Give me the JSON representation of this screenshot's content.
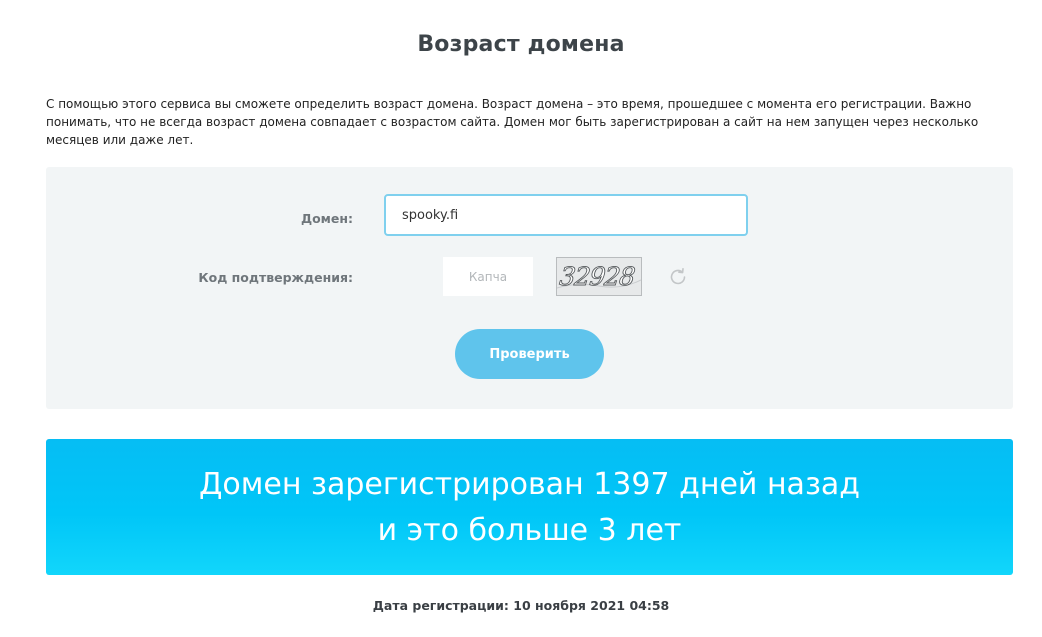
{
  "page": {
    "title": "Возраст домена",
    "description": "С помощью этого сервиса вы сможете определить возраст домена. Возраст домена – это время, прошедшее с момента его регистрации. Важно понимать, что не всегда возраст домена совпадает с возрастом сайта. Домен мог быть зарегистрирован а сайт на нем запущен через несколько месяцев или даже лет."
  },
  "form": {
    "domain_label": "Домен:",
    "domain_value": "spooky.fi",
    "captcha_label": "Код подтверждения:",
    "captcha_placeholder": "Капча",
    "captcha_image_text": "32928",
    "refresh_icon": "refresh-icon",
    "submit_label": "Проверить"
  },
  "result": {
    "line1": "Домен зарегистрирован 1397 дней назад",
    "line2": "и это больше 3 лет",
    "registration_date": "Дата регистрации: 10 ноября 2021 04:58"
  },
  "colors": {
    "accent": "#5fc4ec",
    "banner": "#00c6f8",
    "panel": "#f2f5f6"
  }
}
